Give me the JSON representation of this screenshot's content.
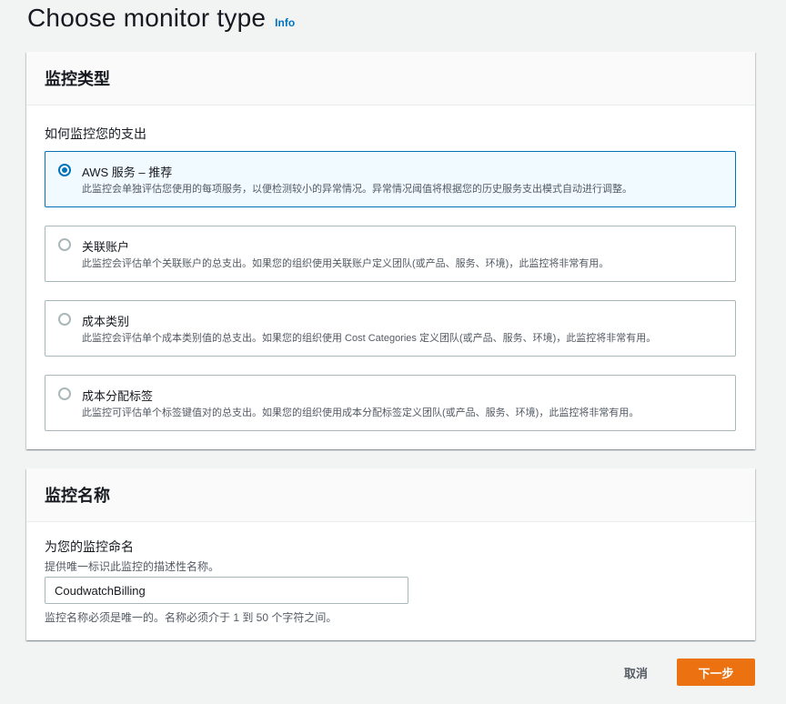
{
  "header": {
    "title": "Choose monitor type",
    "info_link": "Info"
  },
  "monitor_type_panel": {
    "title": "监控类型",
    "question": "如何监控您的支出",
    "options": [
      {
        "title": "AWS 服务 – 推荐",
        "description": "此监控会单独评估您使用的每项服务，以便检测较小的异常情况。异常情况阈值将根据您的历史服务支出模式自动进行调整。",
        "selected": true
      },
      {
        "title": "关联账户",
        "description": "此监控会评估单个关联账户的总支出。如果您的组织使用关联账户定义团队(或产品、服务、环境)，此监控将非常有用。",
        "selected": false
      },
      {
        "title": "成本类别",
        "description": "此监控会评估单个成本类别值的总支出。如果您的组织使用 Cost Categories 定义团队(或产品、服务、环境)，此监控将非常有用。",
        "selected": false
      },
      {
        "title": "成本分配标签",
        "description": "此监控可评估单个标签键值对的总支出。如果您的组织使用成本分配标签定义团队(或产品、服务、环境)，此监控将非常有用。",
        "selected": false
      }
    ]
  },
  "monitor_name_panel": {
    "title": "监控名称",
    "label": "为您的监控命名",
    "description": "提供唯一标识此监控的描述性名称。",
    "value": "CoudwatchBilling",
    "constraint": "监控名称必须是唯一的。名称必须介于 1 到 50 个字符之间。"
  },
  "actions": {
    "cancel": "取消",
    "next": "下一步"
  },
  "colors": {
    "accent": "#0073bb",
    "primary_button": "#ec7211",
    "page_background": "#f2f3f3"
  }
}
